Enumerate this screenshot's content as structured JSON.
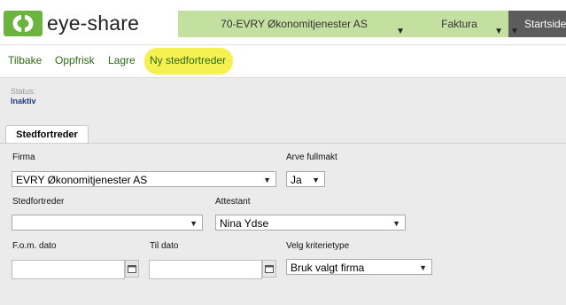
{
  "app": {
    "brand": "eye-share"
  },
  "breadcrumbs": {
    "company": "70-EVRY Økonomitjenester AS",
    "section": "Faktura",
    "home": "Startside"
  },
  "toolbar": {
    "back": "Tilbake",
    "refresh": "Oppfrisk",
    "save": "Lagre",
    "new_substitute": "Ny stedfortreder",
    "highlight_color": "#f4f04a"
  },
  "status": {
    "label": "Status:",
    "value": "Inaktiv"
  },
  "tabs": [
    {
      "label": "Stedfortreder"
    }
  ],
  "form": {
    "firma": {
      "label": "Firma",
      "value": "EVRY Økonomitjenester AS"
    },
    "arve_fullmakt": {
      "label": "Arve fullmakt",
      "value": "Ja"
    },
    "stedfortreder": {
      "label": "Stedfortreder",
      "value": ""
    },
    "attestant": {
      "label": "Attestant",
      "value": "Nina Ydse"
    },
    "fom_dato": {
      "label": "F.o.m. dato",
      "value": ""
    },
    "til_dato": {
      "label": "Til dato",
      "value": ""
    },
    "kriterietype": {
      "label": "Velg kriterietype",
      "value": "Bruk valgt firma"
    }
  },
  "colors": {
    "brand_green": "#6cb33f",
    "crumb_green": "#c4e0a1",
    "link_green": "#2c6b12",
    "status_blue": "#1e3a8a"
  }
}
